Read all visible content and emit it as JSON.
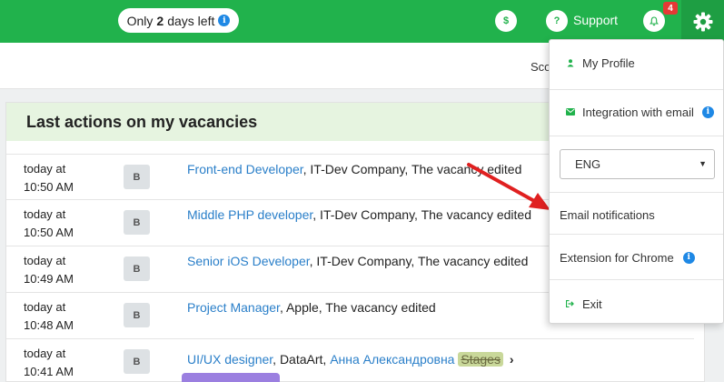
{
  "topbar": {
    "trial_prefix": "Only",
    "trial_days": "2",
    "trial_suffix": "days left",
    "info_glyph": "i",
    "billing_glyph": "$",
    "support_glyph": "?",
    "support_label": "Support",
    "notification_count": "4",
    "accent_color": "#21b24c"
  },
  "subheader": {
    "partial_text": "Sco"
  },
  "panel": {
    "title": "Last actions on my vacancies",
    "rows": [
      {
        "time1": "today at",
        "time2": "10:50 AM",
        "avatar": "B",
        "vacancy": "Front-end Developer",
        "company": ", IT-Dev Company,",
        "action": "The vacancy edited"
      },
      {
        "time1": "today at",
        "time2": "10:50 AM",
        "avatar": "B",
        "vacancy": "Middle PHP developer",
        "company": ", IT-Dev Company,",
        "action": "The vacancy edited"
      },
      {
        "time1": "today at",
        "time2": "10:49 AM",
        "avatar": "B",
        "vacancy": "Senior iOS Developer",
        "company": ", IT-Dev Company,",
        "action": "The vacancy edited"
      },
      {
        "time1": "today at",
        "time2": "10:48 AM",
        "avatar": "B",
        "vacancy": "Project Manager",
        "company": ", Apple,",
        "action": "The vacancy edited"
      },
      {
        "time1": "today at",
        "time2": "10:41 AM",
        "avatar": "B",
        "vacancy": "UI/UX designer",
        "company": ", DataArt,",
        "candidate": "Анна Александровна",
        "stage": "Stages",
        "chevron": "›"
      }
    ]
  },
  "menu": {
    "profile": "My Profile",
    "integration": "Integration with email",
    "language": "ENG",
    "email_notifications": "Email notifications",
    "chrome_extension": "Extension for Chrome",
    "exit": "Exit"
  }
}
